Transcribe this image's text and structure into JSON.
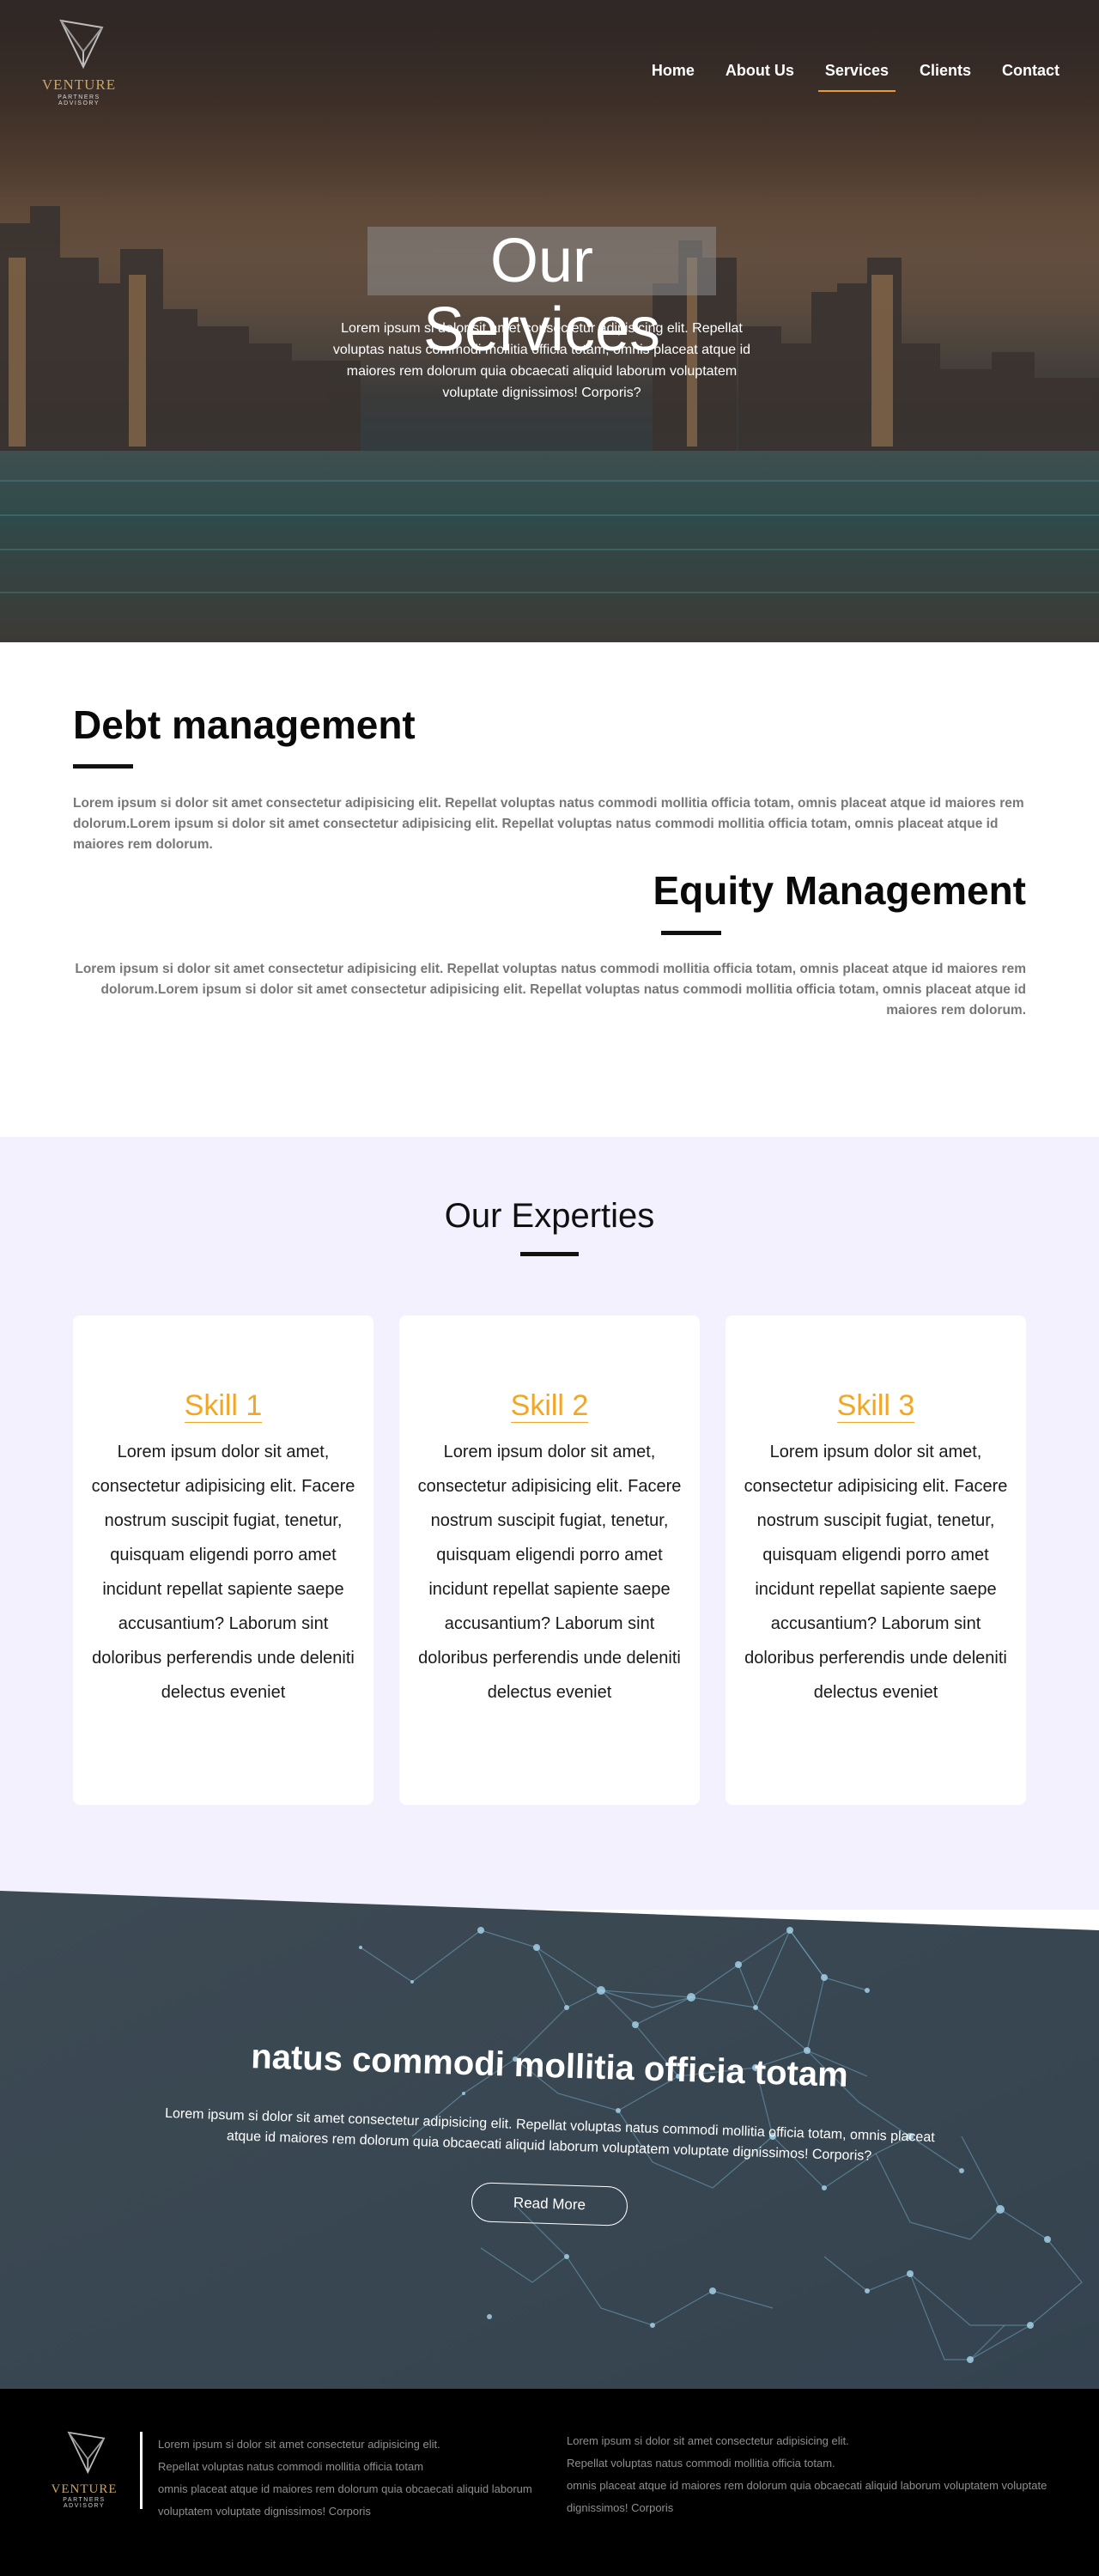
{
  "brand": {
    "name": "VENTURE",
    "tagline": "PARTNERS ADVISORY"
  },
  "nav": {
    "items": [
      {
        "label": "Home",
        "active": false
      },
      {
        "label": "About Us",
        "active": false
      },
      {
        "label": "Services",
        "active": true
      },
      {
        "label": "Clients",
        "active": false
      },
      {
        "label": "Contact",
        "active": false
      }
    ]
  },
  "hero": {
    "title": "Our Services",
    "text": "Lorem ipsum si dolor sit amet consectetur adipisicing elit. Repellat voluptas natus commodi mollitia officia totam, omnis placeat atque id maiores rem dolorum quia obcaecati aliquid laborum voluptatem voluptate dignissimos! Corporis?"
  },
  "services": [
    {
      "title": "Debt management",
      "text": "Lorem ipsum si dolor sit amet consectetur adipisicing elit. Repellat voluptas natus commodi mollitia officia totam, omnis placeat atque id maiores rem dolorum.Lorem ipsum si dolor sit amet consectetur adipisicing elit. Repellat voluptas natus commodi mollitia officia totam, omnis placeat atque id maiores rem dolorum."
    },
    {
      "title": "Equity Management",
      "text": "Lorem ipsum si dolor sit amet consectetur adipisicing elit. Repellat voluptas natus commodi mollitia officia totam, omnis placeat atque id maiores rem dolorum.Lorem ipsum si dolor sit amet consectetur adipisicing elit. Repellat voluptas natus commodi mollitia officia totam, omnis placeat atque id maiores rem dolorum."
    }
  ],
  "expertise": {
    "title": "Our Experties",
    "cards": [
      {
        "title": "Skill 1",
        "text": "Lorem ipsum dolor sit amet, consectetur adipisicing elit. Facere nostrum suscipit fugiat, tenetur, quisquam eligendi porro amet incidunt repellat sapiente saepe accusantium? Laborum sint doloribus perferendis unde deleniti delectus eveniet"
      },
      {
        "title": "Skill 2",
        "text": "Lorem ipsum dolor sit amet, consectetur adipisicing elit. Facere nostrum suscipit fugiat, tenetur, quisquam eligendi porro amet incidunt repellat sapiente saepe accusantium? Laborum sint doloribus perferendis unde deleniti delectus eveniet"
      },
      {
        "title": "Skill 3",
        "text": "Lorem ipsum dolor sit amet, consectetur adipisicing elit. Facere nostrum suscipit fugiat, tenetur, quisquam eligendi porro amet incidunt repellat sapiente saepe accusantium? Laborum sint doloribus perferendis unde deleniti delectus eveniet"
      }
    ]
  },
  "cta": {
    "title": "natus commodi mollitia officia totam",
    "text": "Lorem ipsum si dolor sit amet consectetur adipisicing elit. Repellat voluptas natus commodi mollitia officia totam, omnis placeat atque id maiores rem dolorum quia obcaecati aliquid laborum voluptatem voluptate dignissimos! Corporis?",
    "button": "Read More"
  },
  "footer": {
    "col1": [
      "Lorem ipsum si dolor sit amet consectetur adipisicing elit.",
      "Repellat voluptas natus commodi mollitia officia totam",
      "omnis placeat atque id maiores rem dolorum quia obcaecati aliquid laborum",
      "voluptatem voluptate dignissimos! Corporis"
    ],
    "col2": [
      "Lorem ipsum si dolor sit amet consectetur adipisicing elit.",
      "Repellat voluptas natus commodi mollitia officia totam.",
      "omnis placeat atque id maiores rem dolorum quia obcaecati aliquid laborum voluptatem voluptate",
      "dignissimos! Corporis"
    ]
  },
  "colors": {
    "accent": "#e89a3c",
    "skill": "#f2a623",
    "expertise_bg": "#f2f1fd",
    "network_bg": "#3b4a55"
  }
}
